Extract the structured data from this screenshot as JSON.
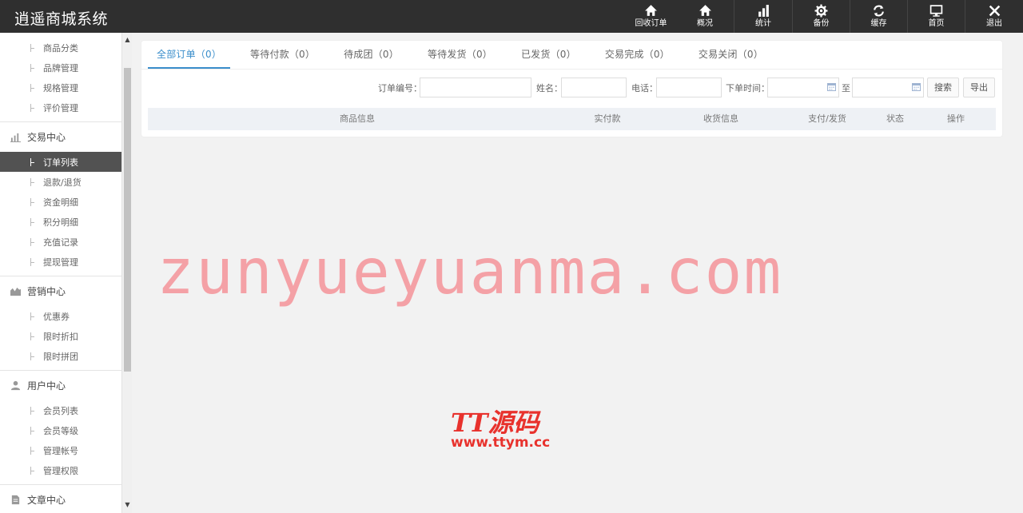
{
  "app": {
    "title": "逍遥商城系统"
  },
  "topnav": [
    {
      "label": "回收订单",
      "icon": "home-icon"
    },
    {
      "label": "概况",
      "icon": "home-icon"
    },
    {
      "label": "统计",
      "icon": "bar-chart-icon"
    },
    {
      "label": "备份",
      "icon": "gear-icon"
    },
    {
      "label": "缓存",
      "icon": "refresh-icon"
    },
    {
      "label": "首页",
      "icon": "monitor-icon"
    },
    {
      "label": "退出",
      "icon": "close-icon"
    }
  ],
  "sidebar": {
    "goods_items": [
      "商品分类",
      "品牌管理",
      "规格管理",
      "评价管理"
    ],
    "trade": {
      "title": "交易中心",
      "items": [
        "订单列表",
        "退款/退货",
        "资金明细",
        "积分明细",
        "充值记录",
        "提现管理"
      ]
    },
    "marketing": {
      "title": "营销中心",
      "items": [
        "优惠券",
        "限时折扣",
        "限时拼团"
      ]
    },
    "user": {
      "title": "用户中心",
      "items": [
        "会员列表",
        "会员等级",
        "管理帐号",
        "管理权限"
      ]
    },
    "article": {
      "title": "文章中心"
    }
  },
  "tabs": [
    "全部订单（0）",
    "等待付款（0）",
    "待成团（0）",
    "等待发货（0）",
    "已发货（0）",
    "交易完成（0）",
    "交易关闭（0）"
  ],
  "filters": {
    "order_no_label": "订单编号：",
    "name_label": "姓名：",
    "phone_label": "电话：",
    "time_label": "下单时间：",
    "to_label": "至",
    "order_no_value": "",
    "name_value": "",
    "phone_value": "",
    "start_date": "",
    "end_date": "",
    "search_button": "搜索",
    "export_button": "导出"
  },
  "table": {
    "columns": [
      "商品信息",
      "实付款",
      "收货信息",
      "支付/发货",
      "状态",
      "操作"
    ]
  },
  "watermark": {
    "big_text": "zunyueyuanma.com",
    "logo_text": "TT源码",
    "logo_url": "www.ttym.cc"
  },
  "colors": {
    "topbar": "#2f2f2f",
    "accent": "#3a8ecb",
    "active_menu": "#525252"
  }
}
